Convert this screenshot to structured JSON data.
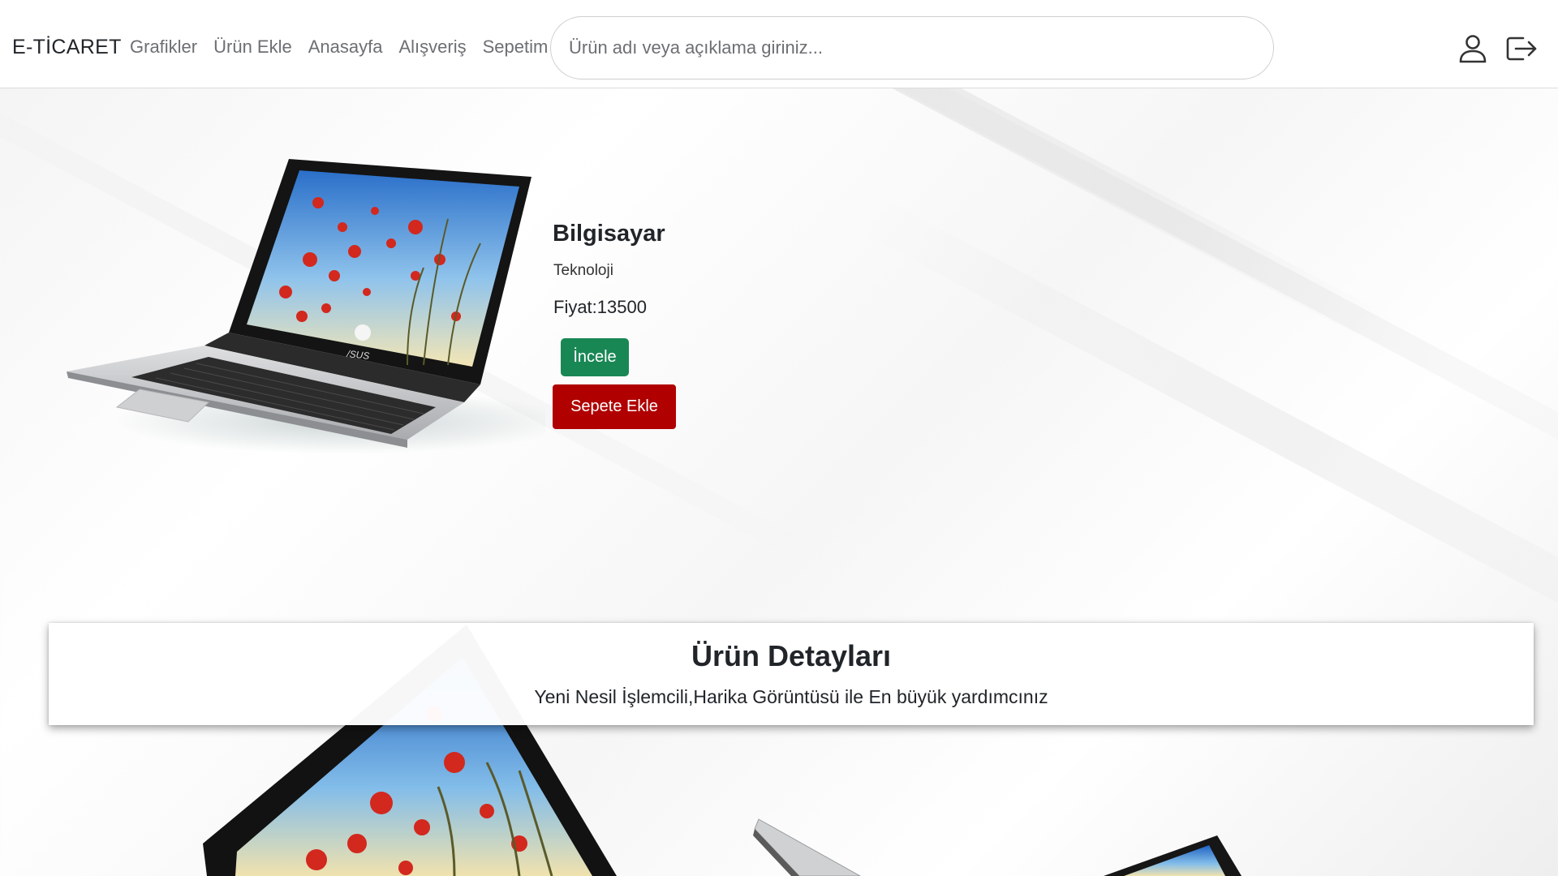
{
  "navbar": {
    "brand": "E-TİCARET",
    "links": [
      "Grafikler",
      "Ürün Ekle",
      "Anasayfa",
      "Alışveriş",
      "Sepetim"
    ],
    "search_placeholder": "Ürün adı veya açıklama giriniz...",
    "icons": [
      "user-icon",
      "logout-icon"
    ]
  },
  "product": {
    "name": "Bilgisayar",
    "category": "Teknoloji",
    "price": "Fiyat:13500",
    "inspect_label": "İncele",
    "add_to_cart_label": "Sepete Ekle",
    "laptop_brand": "/SUS"
  },
  "details": {
    "title": "Ürün Detayları",
    "description": "Yeni Nesil İşlemcili,Harika Görüntüsü ile En büyük yardımcınız"
  },
  "colors": {
    "inspect_button": "#198754",
    "cart_button": "#b00000"
  }
}
